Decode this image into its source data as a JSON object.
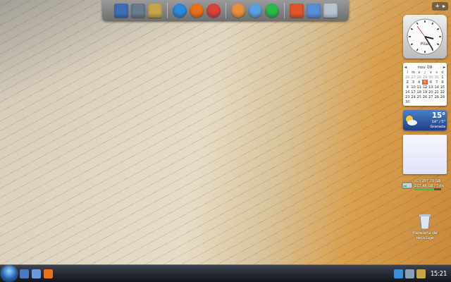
{
  "sidebar": {
    "controls": [
      "+",
      "▸"
    ]
  },
  "clock": {
    "label": "Pilar"
  },
  "calendar": {
    "month": "nov 09",
    "nav": [
      "◂",
      "▸"
    ],
    "weekdays": [
      "l",
      "m",
      "x",
      "j",
      "v",
      "s",
      "d"
    ],
    "days": [
      {
        "day": "26",
        "muted": true,
        "selected": false
      },
      {
        "day": "27",
        "muted": true,
        "selected": false
      },
      {
        "day": "28",
        "muted": true,
        "selected": false
      },
      {
        "day": "29",
        "muted": true,
        "selected": false
      },
      {
        "day": "30",
        "muted": true,
        "selected": false
      },
      {
        "day": "31",
        "muted": true,
        "selected": false
      },
      {
        "day": "1",
        "muted": false,
        "selected": false
      },
      {
        "day": "2",
        "muted": false,
        "selected": false
      },
      {
        "day": "3",
        "muted": false,
        "selected": false
      },
      {
        "day": "4",
        "muted": false,
        "selected": false
      },
      {
        "day": "5",
        "muted": false,
        "selected": true
      },
      {
        "day": "6",
        "muted": false,
        "selected": false
      },
      {
        "day": "7",
        "muted": false,
        "selected": false
      },
      {
        "day": "8",
        "muted": false,
        "selected": false
      },
      {
        "day": "9",
        "muted": false,
        "selected": false
      },
      {
        "day": "10",
        "muted": false,
        "selected": false
      },
      {
        "day": "11",
        "muted": false,
        "selected": false
      },
      {
        "day": "12",
        "muted": false,
        "selected": false
      },
      {
        "day": "13",
        "muted": false,
        "selected": false
      },
      {
        "day": "14",
        "muted": false,
        "selected": false
      },
      {
        "day": "15",
        "muted": false,
        "selected": false
      },
      {
        "day": "16",
        "muted": false,
        "selected": false
      },
      {
        "day": "17",
        "muted": false,
        "selected": false
      },
      {
        "day": "18",
        "muted": false,
        "selected": false
      },
      {
        "day": "19",
        "muted": false,
        "selected": false
      },
      {
        "day": "20",
        "muted": false,
        "selected": false
      },
      {
        "day": "21",
        "muted": false,
        "selected": false
      },
      {
        "day": "22",
        "muted": false,
        "selected": false
      },
      {
        "day": "23",
        "muted": false,
        "selected": false
      },
      {
        "day": "24",
        "muted": false,
        "selected": false
      },
      {
        "day": "25",
        "muted": false,
        "selected": false
      },
      {
        "day": "26",
        "muted": false,
        "selected": false
      },
      {
        "day": "27",
        "muted": false,
        "selected": false
      },
      {
        "day": "28",
        "muted": false,
        "selected": false
      },
      {
        "day": "29",
        "muted": false,
        "selected": false
      },
      {
        "day": "30",
        "muted": false,
        "selected": false
      }
    ]
  },
  "weather": {
    "temperature": "15°",
    "range": "14° / 5°",
    "city": "Granada"
  },
  "drive": {
    "name": "(C:) 297.78 GB",
    "free": "217.48 GB / 74%",
    "level": 0.74
  },
  "recycle_bin": {
    "label": "Papelera de reciclaje"
  },
  "taskbar": {
    "time": "15:21"
  }
}
